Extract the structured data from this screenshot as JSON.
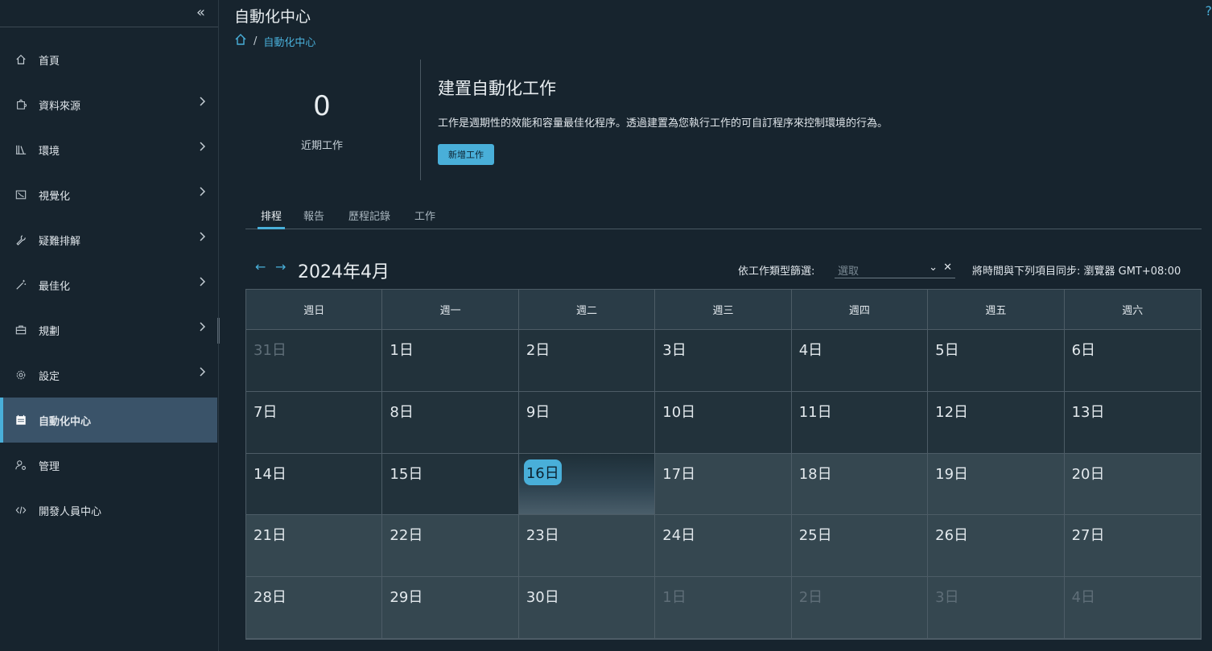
{
  "sidebar": {
    "collapse_icon": "double-chevron-left-icon",
    "items": [
      {
        "label": "首頁",
        "icon": "home-icon",
        "chevron": false
      },
      {
        "label": "資料來源",
        "icon": "puzzle-icon",
        "chevron": true
      },
      {
        "label": "環境",
        "icon": "books-icon",
        "chevron": true
      },
      {
        "label": "視覺化",
        "icon": "chart-icon",
        "chevron": true
      },
      {
        "label": "疑難排解",
        "icon": "wrench-icon",
        "chevron": true
      },
      {
        "label": "最佳化",
        "icon": "wand-icon",
        "chevron": true
      },
      {
        "label": "規劃",
        "icon": "briefcase-icon",
        "chevron": true
      },
      {
        "label": "設定",
        "icon": "gear-icon",
        "chevron": true
      },
      {
        "label": "自動化中心",
        "icon": "calendar-icon",
        "chevron": false,
        "active": true
      },
      {
        "label": "管理",
        "icon": "user-gear-icon",
        "chevron": false
      },
      {
        "label": "開發人員中心",
        "icon": "code-icon",
        "chevron": false
      }
    ]
  },
  "header": {
    "title": "自動化中心",
    "breadcrumb_current": "自動化中心"
  },
  "summary": {
    "count": "0",
    "count_label": "近期工作"
  },
  "create": {
    "title": "建置自動化工作",
    "description": "工作是週期性的效能和容量最佳化程序。透過建置為您執行工作的可自訂程序來控制環境的行為。",
    "button_label": "新增工作"
  },
  "tabs": [
    "排程",
    "報告",
    "歷程記錄",
    "工作"
  ],
  "calendar": {
    "month_label": "2024年4月",
    "filter_label": "依工作類型篩選:",
    "filter_placeholder": "選取",
    "sync_label": "將時間與下列項目同步: 瀏覽器 GMT+08:00",
    "weekdays": [
      "週日",
      "週一",
      "週二",
      "週三",
      "週四",
      "週五",
      "週六"
    ],
    "days": [
      {
        "label": "31日",
        "state": "outside"
      },
      {
        "label": "1日",
        "state": "past"
      },
      {
        "label": "2日",
        "state": "past"
      },
      {
        "label": "3日",
        "state": "past"
      },
      {
        "label": "4日",
        "state": "past"
      },
      {
        "label": "5日",
        "state": "past"
      },
      {
        "label": "6日",
        "state": "past"
      },
      {
        "label": "7日",
        "state": "past"
      },
      {
        "label": "8日",
        "state": "past"
      },
      {
        "label": "9日",
        "state": "past"
      },
      {
        "label": "10日",
        "state": "past"
      },
      {
        "label": "11日",
        "state": "past"
      },
      {
        "label": "12日",
        "state": "past"
      },
      {
        "label": "13日",
        "state": "past"
      },
      {
        "label": "14日",
        "state": "past"
      },
      {
        "label": "15日",
        "state": "past"
      },
      {
        "label": "16日",
        "state": "today"
      },
      {
        "label": "17日",
        "state": "future"
      },
      {
        "label": "18日",
        "state": "future"
      },
      {
        "label": "19日",
        "state": "future"
      },
      {
        "label": "20日",
        "state": "future"
      },
      {
        "label": "21日",
        "state": "future"
      },
      {
        "label": "22日",
        "state": "future"
      },
      {
        "label": "23日",
        "state": "future"
      },
      {
        "label": "24日",
        "state": "future"
      },
      {
        "label": "25日",
        "state": "future"
      },
      {
        "label": "26日",
        "state": "future"
      },
      {
        "label": "27日",
        "state": "future"
      },
      {
        "label": "28日",
        "state": "future"
      },
      {
        "label": "29日",
        "state": "future"
      },
      {
        "label": "30日",
        "state": "future"
      },
      {
        "label": "1日",
        "state": "outside-future"
      },
      {
        "label": "2日",
        "state": "outside-future"
      },
      {
        "label": "3日",
        "state": "outside-future"
      },
      {
        "label": "4日",
        "state": "outside-future"
      }
    ]
  },
  "colors": {
    "accent": "#49afd9",
    "background": "#17242e",
    "active_nav": "#3a5369"
  }
}
